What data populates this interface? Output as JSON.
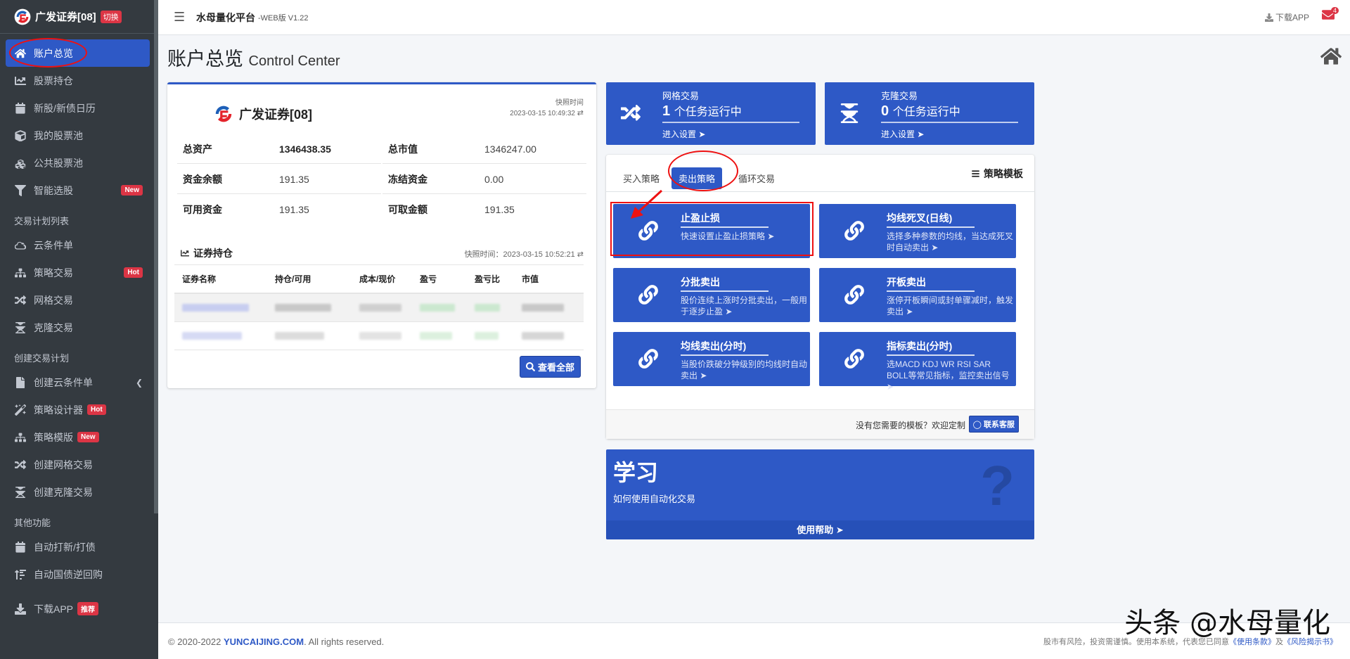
{
  "brand": {
    "name": "广发证券[08]",
    "switch_label": "切换"
  },
  "sidebar": {
    "items": [
      {
        "label": "账户总览",
        "icon": "home-icon",
        "active": true
      },
      {
        "label": "股票持仓",
        "icon": "line-chart-icon"
      },
      {
        "label": "新股/新债日历",
        "icon": "calendar-icon"
      },
      {
        "label": "我的股票池",
        "icon": "cube-icon"
      },
      {
        "label": "公共股票池",
        "icon": "cubes-icon"
      },
      {
        "label": "智能选股",
        "icon": "filter-icon",
        "badge": "New"
      }
    ],
    "section_plan": "交易计划列表",
    "plan_items": [
      {
        "label": "云条件单",
        "icon": "cloud-icon"
      },
      {
        "label": "策略交易",
        "icon": "sitemap-icon",
        "badge": "Hot"
      },
      {
        "label": "网格交易",
        "icon": "shuffle-icon"
      },
      {
        "label": "克隆交易",
        "icon": "dna-icon"
      }
    ],
    "section_create": "创建交易计划",
    "create_items": [
      {
        "label": "创建云条件单",
        "icon": "file-icon"
      },
      {
        "label": "策略设计器",
        "icon": "magic-icon",
        "badge": "Hot"
      },
      {
        "label": "策略模版",
        "icon": "sitemap-icon",
        "badge": "New"
      },
      {
        "label": "创建网格交易",
        "icon": "shuffle-icon"
      },
      {
        "label": "创建克隆交易",
        "icon": "dna-icon"
      }
    ],
    "section_other": "其他功能",
    "other_items": [
      {
        "label": "自动打新/打债",
        "icon": "calendar-icon"
      },
      {
        "label": "自动国债逆回购",
        "icon": "sort-icon"
      }
    ],
    "download": {
      "label": "下载APP",
      "badge": "推荐"
    }
  },
  "header": {
    "title": "水母量化平台",
    "version": "-WEB版 V1.22",
    "download_label": "下载APP",
    "mail_count": "4"
  },
  "page": {
    "title": "账户总览",
    "subtitle": "Control Center"
  },
  "account": {
    "broker": "广发证券[08]",
    "snapshot_label": "快照时间",
    "snapshot_time": "2023-03-15 10:49:32",
    "rows": [
      {
        "k1": "总资产",
        "v1": "1346438.35",
        "k2": "总市值",
        "v2": "1346247.00"
      },
      {
        "k1": "资金余额",
        "v1": "191.35",
        "k2": "冻结资金",
        "v2": "0.00"
      },
      {
        "k1": "可用资金",
        "v1": "191.35",
        "k2": "可取金额",
        "v2": "191.35"
      }
    ],
    "holdings_title": "证券持仓",
    "holdings_snapshot": "快照时间：2023-03-15 10:52:21",
    "columns": [
      "证券名称",
      "持仓/可用",
      "成本/现价",
      "盈亏",
      "盈亏比",
      "市值"
    ],
    "view_all": "查看全部"
  },
  "grid": {
    "title": "网格交易",
    "count": "1",
    "running": "个任务运行中",
    "link": "进入设置"
  },
  "clone": {
    "title": "克隆交易",
    "count": "0",
    "running": "个任务运行中",
    "link": "进入设置"
  },
  "strategy": {
    "tabs": [
      "买入策略",
      "卖出策略",
      "循环交易"
    ],
    "template_link": "策略模板",
    "tiles": [
      {
        "title": "止盈止损",
        "desc": "快速设置止盈止损策略"
      },
      {
        "title": "均线死叉(日线)",
        "desc": "选择多种参数的均线，当达成死叉时自动卖出"
      },
      {
        "title": "分批卖出",
        "desc": "股价连续上涨时分批卖出，一般用于逐步止盈"
      },
      {
        "title": "开板卖出",
        "desc": "涨停开板瞬间或封单骤减时，触发卖出"
      },
      {
        "title": "均线卖出(分时)",
        "desc": "当股价跌破分钟级别的均线时自动卖出"
      },
      {
        "title": "指标卖出(分时)",
        "desc": "选MACD KDJ WR RSI SAR BOLL等常见指标，监控卖出信号"
      }
    ],
    "need_template": "没有您需要的模板？欢迎定制",
    "contact": "联系客服"
  },
  "learn": {
    "title": "学习",
    "subtitle": "如何使用自动化交易",
    "help": "使用帮助"
  },
  "footer": {
    "copyright_prefix": "© 2020-2022 ",
    "site": "YUNCAIJING.COM",
    "copyright_suffix": ". All rights reserved.",
    "risk": "股市有风险，投资需谨慎。使用本系统，代表您已同意",
    "terms": "《使用条款》",
    "and": "及",
    "risk_notice": "《风险揭示书》"
  },
  "watermark": "头条 @水母量化",
  "colors": {
    "accent": "#2e59c6",
    "sidebar": "#343a40",
    "badge": "#dc3545",
    "annotation": "#ee1111"
  }
}
